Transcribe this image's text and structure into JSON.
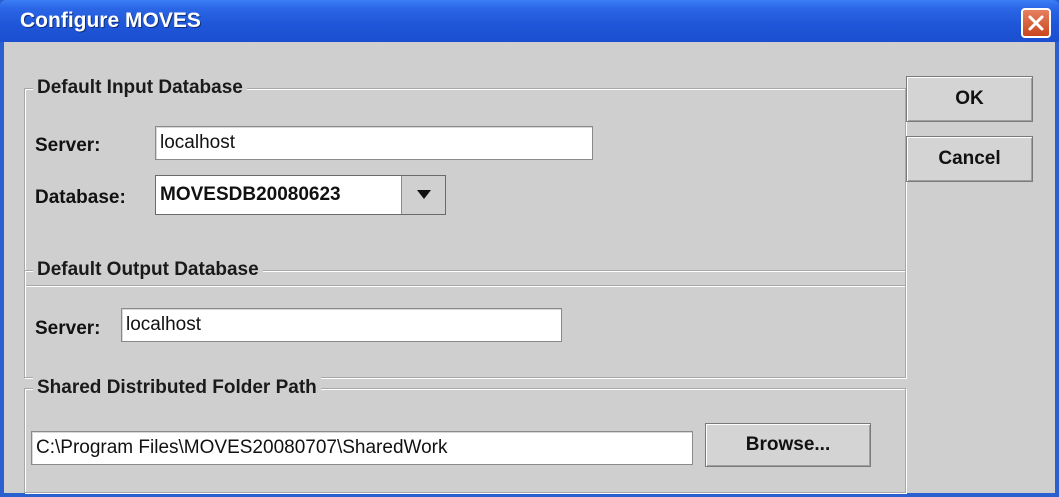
{
  "window": {
    "title": "Configure MOVES"
  },
  "input_db": {
    "group_title": "Default Input Database",
    "server_label": "Server:",
    "server_value": "localhost",
    "database_label": "Database:",
    "database_value": "MOVESDB20080623"
  },
  "output_db": {
    "group_title": "Default Output Database",
    "server_label": "Server:",
    "server_value": "localhost"
  },
  "shared_folder": {
    "group_title": "Shared Distributed Folder Path",
    "path_value": "C:\\Program Files\\MOVES20080707\\SharedWork",
    "browse_label": "Browse..."
  },
  "buttons": {
    "ok_label": "OK",
    "cancel_label": "Cancel"
  },
  "icons": {
    "close": "close-icon",
    "dropdown": "chevron-down-icon"
  },
  "colors": {
    "titlebar": "#1f55d8",
    "close": "#c8461f",
    "dialog_bg": "#cfcfcf"
  }
}
